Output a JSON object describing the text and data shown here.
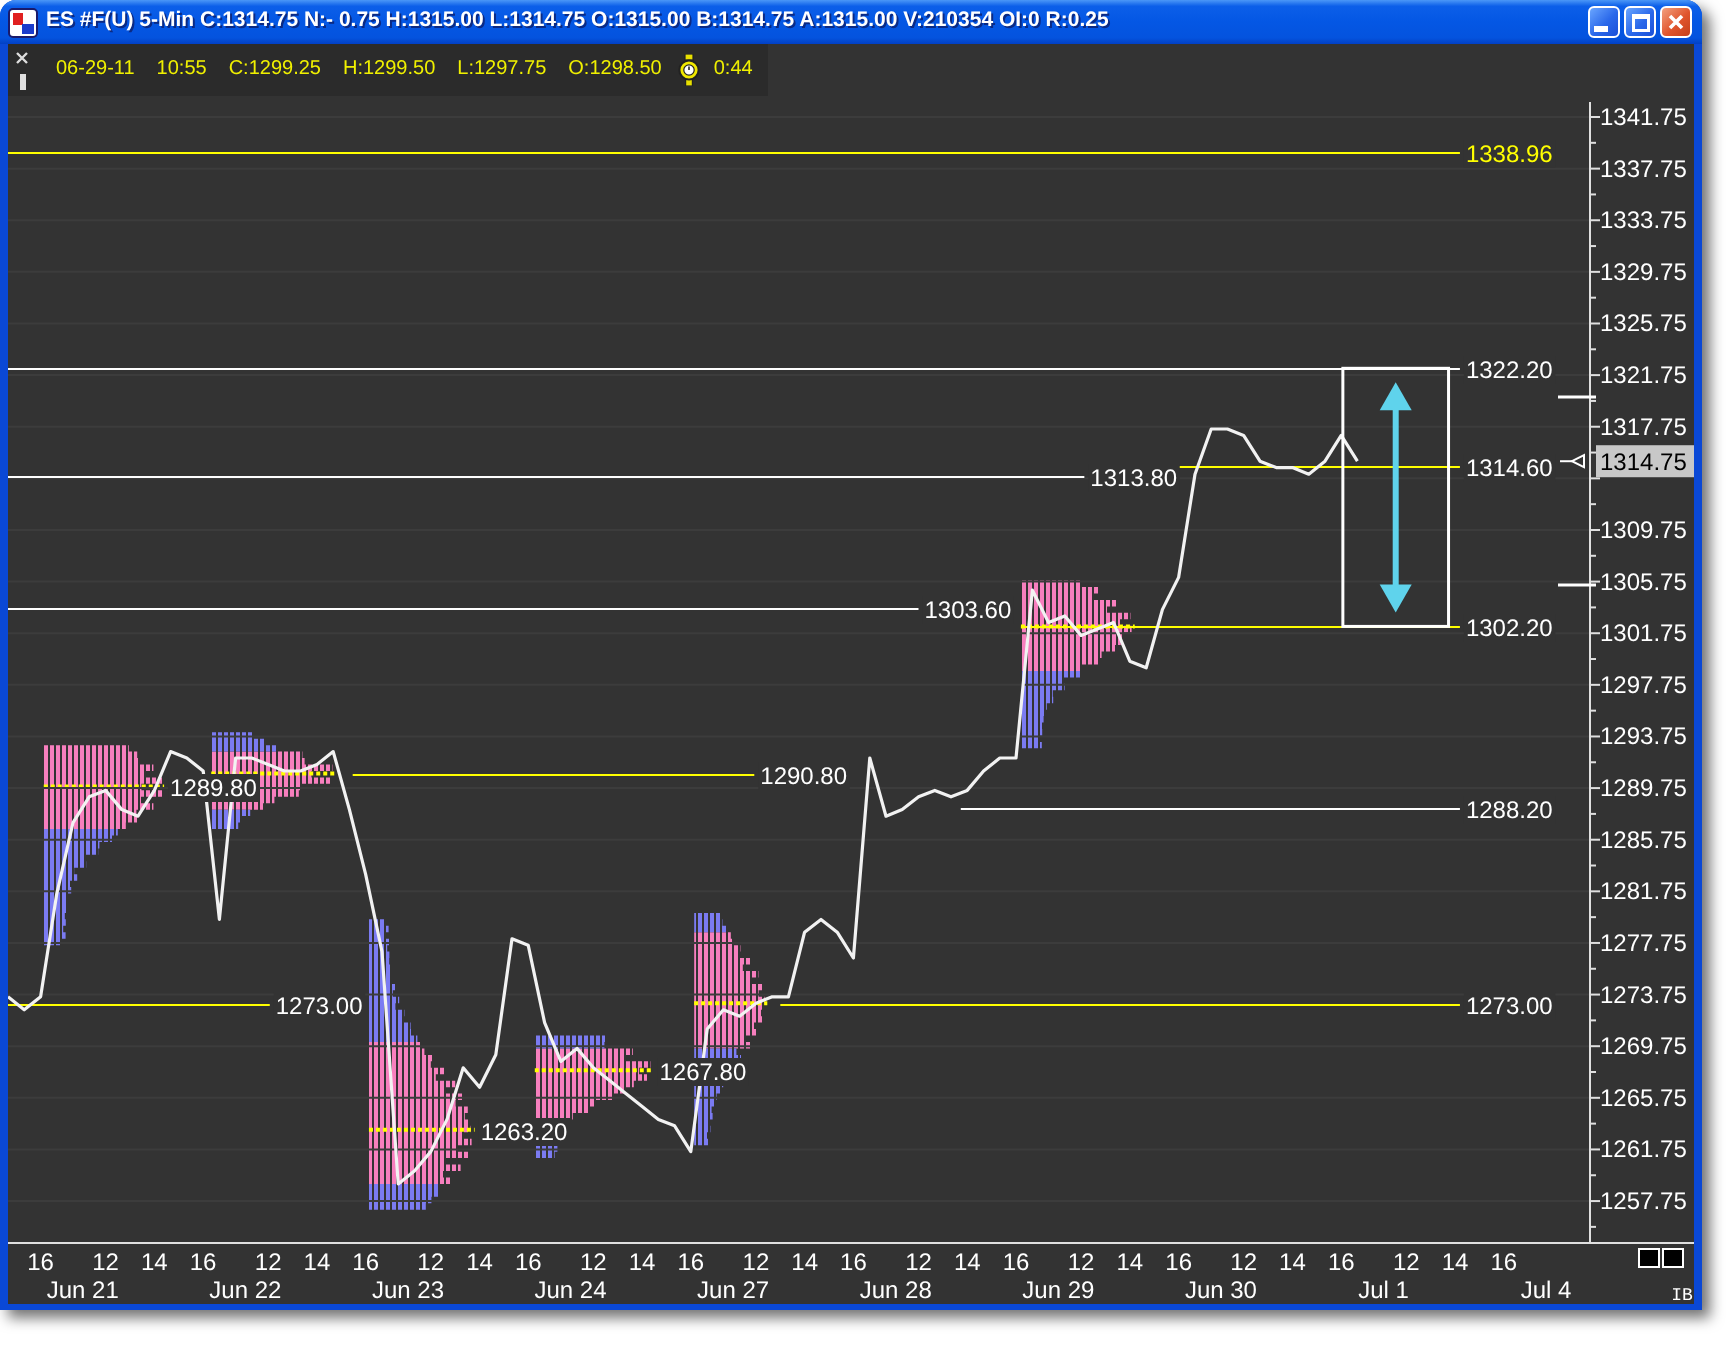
{
  "window": {
    "title": "ES #F(U) 5-Min C:1314.75 N:- 0.75 H:1315.00 L:1314.75 O:1315.00 B:1314.75 A:1315.00 V:210354 OI:0 R:0.25"
  },
  "info_bar": {
    "items": [
      "06-29-11",
      "10:55",
      "C:1299.25",
      "H:1299.50",
      "L:1297.75",
      "O:1298.50"
    ],
    "timer": "0:44"
  },
  "chart": {
    "chart_data": {
      "type": "line",
      "grid": true,
      "categories": [
        null,
        null,
        "16",
        null,
        null,
        null,
        "12",
        null,
        null,
        "14",
        null,
        null,
        "16",
        null,
        null,
        null,
        "12",
        null,
        null,
        "14",
        null,
        null,
        "16",
        null,
        null,
        null,
        "12",
        null,
        null,
        "14",
        null,
        null,
        "16",
        null,
        null,
        null,
        "12",
        null,
        null,
        "14",
        null,
        null,
        "16",
        null,
        null,
        null,
        "12",
        null,
        null,
        "14",
        null,
        null,
        "16",
        null,
        null,
        null,
        "12",
        null,
        null,
        "14",
        null,
        null,
        "16",
        null,
        null,
        null,
        "12",
        null,
        null,
        "14",
        null,
        null,
        "16",
        null,
        null,
        null,
        "12",
        null,
        null,
        "14",
        null,
        null,
        "16",
        null,
        null,
        null,
        "12",
        null,
        null,
        "14",
        null,
        null,
        "16",
        null,
        null,
        null,
        null,
        null
      ],
      "values": [
        1273.5,
        1272.5,
        1273.5,
        1281.5,
        1287,
        1289,
        1289.5,
        1288,
        1287.5,
        1289.5,
        1292.5,
        1292,
        1291,
        1279.5,
        1292,
        1292,
        1291.5,
        1291,
        1291,
        1291.5,
        1292.5,
        1288,
        1283,
        1277,
        1259,
        1260,
        1261.5,
        1264,
        1268,
        1266.5,
        1269,
        1278,
        1277.5,
        1271.5,
        1268.5,
        1269.5,
        1268,
        1267,
        1266,
        1265,
        1264,
        1263.5,
        1261.5,
        1271,
        1272.5,
        1272,
        1273,
        1273.5,
        1273.5,
        1278.5,
        1279.5,
        1278.5,
        1276.5,
        1292,
        1287.5,
        1288,
        1289,
        1289.5,
        1289,
        1289.5,
        1291,
        1292,
        1292,
        1305,
        1302.5,
        1303,
        1301.5,
        1302,
        1302.5,
        1299.5,
        1299,
        1303.5,
        1306,
        1314,
        1317.5,
        1317.5,
        1317,
        1315,
        1314.5,
        1314.5,
        1314,
        1315,
        1317,
        1315,
        null,
        null,
        null,
        null,
        null,
        null,
        null,
        null,
        null,
        null,
        null,
        null,
        null,
        null
      ],
      "ylim": [
        1254.5,
        1343.3
      ],
      "yticks": [
        1257.75,
        1261.75,
        1265.75,
        1269.75,
        1273.75,
        1277.75,
        1281.75,
        1285.75,
        1289.75,
        1293.75,
        1297.75,
        1301.75,
        1305.75,
        1309.75,
        1317.75,
        1321.75,
        1325.75,
        1329.75,
        1333.75,
        1337.75,
        1341.75
      ],
      "ref_lines": [
        {
          "axis": "y",
          "value": 1338.96,
          "color": "#ffff00",
          "label": "1338.96"
        },
        {
          "axis": "y",
          "value": 1322.2,
          "color": "#ffffff",
          "label": "1322.20"
        },
        {
          "axis": "y",
          "value": 1314.6,
          "color": "#ffff00",
          "label": "1314.60"
        },
        {
          "axis": "y",
          "value": 1313.8,
          "color": "#ffffff",
          "label": "1313.80"
        },
        {
          "axis": "y",
          "value": 1303.6,
          "color": "#ffffff",
          "label": "1303.60"
        },
        {
          "axis": "y",
          "value": 1302.2,
          "color": "#ffff00",
          "label": "1302.20"
        },
        {
          "axis": "y",
          "value": 1290.8,
          "color": "#ffff00",
          "label": "1290.80"
        },
        {
          "axis": "y",
          "value": 1288.2,
          "color": "#ffffff",
          "label": "1288.20"
        },
        {
          "axis": "y",
          "value": 1273.0,
          "color": "#ffff00",
          "label": "1273.00"
        }
      ],
      "annotations": [
        "1289.80",
        "1273.00",
        "1263.20",
        "1267.80"
      ]
    },
    "price_tag": "1314.75",
    "date_labels": [
      "Jun 21",
      "Jun 22",
      "Jun 23",
      "Jun 24",
      "Jun 27",
      "Jun 28",
      "Jun 29",
      "Jun 30",
      "Jul 1",
      "Jul 4"
    ],
    "corner_label": "IB"
  }
}
